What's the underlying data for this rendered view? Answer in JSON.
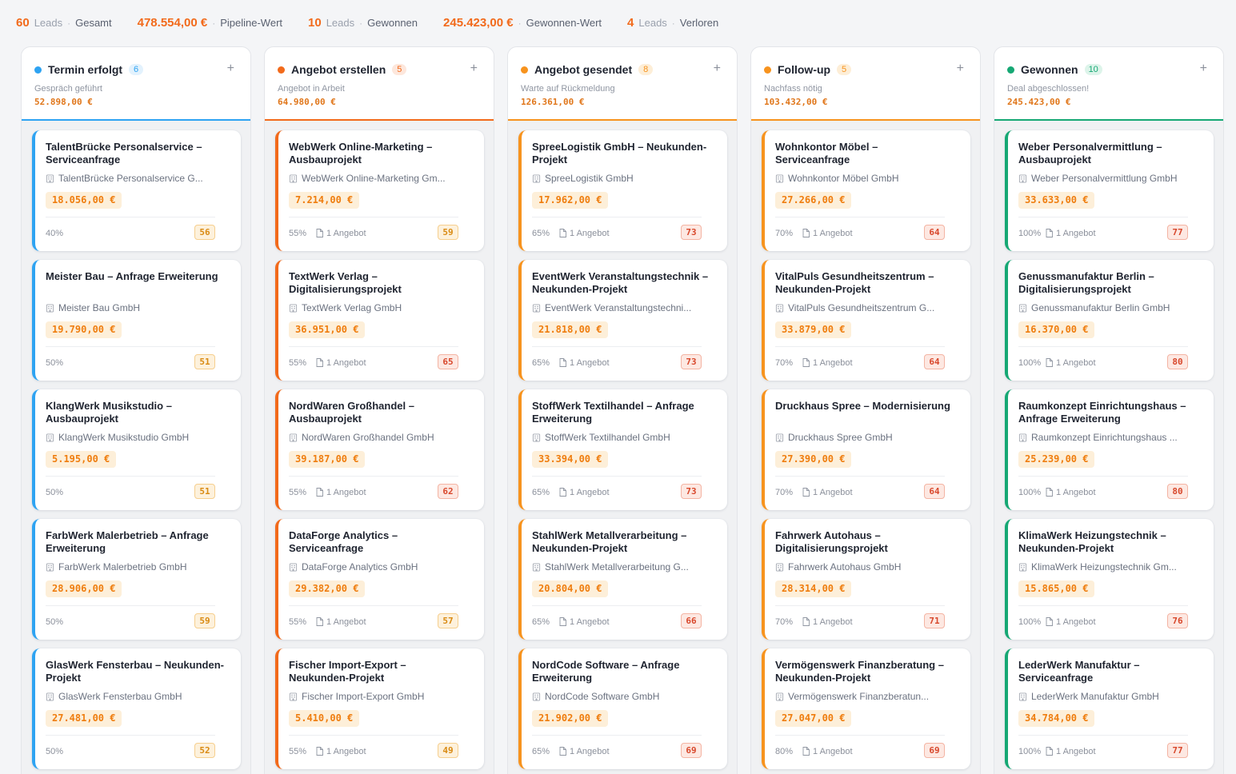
{
  "stats": [
    {
      "value": "60",
      "unit": "Leads",
      "label": "Gesamt"
    },
    {
      "value": "478.554,00 €",
      "unit": "",
      "label": "Pipeline-Wert"
    },
    {
      "value": "10",
      "unit": "Leads",
      "label": "Gewonnen"
    },
    {
      "value": "245.423,00 €",
      "unit": "",
      "label": "Gewonnen-Wert"
    },
    {
      "value": "4",
      "unit": "Leads",
      "label": "Verloren"
    }
  ],
  "columns": [
    {
      "title": "Termin erfolgt",
      "count": "6",
      "subtitle": "Gespräch geführt",
      "sum": "52.898,00 €",
      "accent": "#2ea3f2",
      "accent_soft": "#e3f2fd",
      "add_icon": "plus-icon",
      "cards": [
        {
          "title": "TalentBrücke Personalservice – Serviceanfrage",
          "company": "TalentBrücke Personalservice G...",
          "amount": "18.056,00 €",
          "prob": "40%",
          "offer": "",
          "score": "56",
          "score_color": "yellow"
        },
        {
          "title": "Meister Bau – Anfrage Erweiterung",
          "company": "Meister Bau GmbH",
          "amount": "19.790,00 €",
          "prob": "50%",
          "offer": "",
          "score": "51",
          "score_color": "yellow"
        },
        {
          "title": "KlangWerk Musikstudio – Ausbauprojekt",
          "company": "KlangWerk Musikstudio GmbH",
          "amount": "5.195,00 €",
          "prob": "50%",
          "offer": "",
          "score": "51",
          "score_color": "yellow"
        },
        {
          "title": "FarbWerk Malerbetrieb – Anfrage Erweiterung",
          "company": "FarbWerk Malerbetrieb GmbH",
          "amount": "28.906,00 €",
          "prob": "50%",
          "offer": "",
          "score": "59",
          "score_color": "yellow"
        },
        {
          "title": "GlasWerk Fensterbau – Neukunden-Projekt",
          "company": "GlasWerk Fensterbau GmbH",
          "amount": "27.481,00 €",
          "prob": "50%",
          "offer": "",
          "score": "52",
          "score_color": "yellow"
        }
      ]
    },
    {
      "title": "Angebot erstellen",
      "count": "5",
      "subtitle": "Angebot in Arbeit",
      "sum": "64.980,00 €",
      "accent": "#f26a1b",
      "accent_soft": "#fde7dc",
      "add_icon": "plus-icon",
      "cards": [
        {
          "title": "WebWerk Online-Marketing – Ausbauprojekt",
          "company": "WebWerk Online-Marketing Gm...",
          "amount": "7.214,00 €",
          "prob": "55%",
          "offer": "1 Angebot",
          "score": "59",
          "score_color": "yellow"
        },
        {
          "title": "TextWerk Verlag – Digitalisierungsprojekt",
          "company": "TextWerk Verlag GmbH",
          "amount": "36.951,00 €",
          "prob": "55%",
          "offer": "1 Angebot",
          "score": "65",
          "score_color": "red"
        },
        {
          "title": "NordWaren Großhandel – Ausbauprojekt",
          "company": "NordWaren Großhandel GmbH",
          "amount": "39.187,00 €",
          "prob": "55%",
          "offer": "1 Angebot",
          "score": "62",
          "score_color": "red"
        },
        {
          "title": "DataForge Analytics – Serviceanfrage",
          "company": "DataForge Analytics GmbH",
          "amount": "29.382,00 €",
          "prob": "55%",
          "offer": "1 Angebot",
          "score": "57",
          "score_color": "yellow"
        },
        {
          "title": "Fischer Import-Export – Neukunden-Projekt",
          "company": "Fischer Import-Export GmbH",
          "amount": "5.410,00 €",
          "prob": "55%",
          "offer": "1 Angebot",
          "score": "49",
          "score_color": "yellow"
        }
      ]
    },
    {
      "title": "Angebot gesendet",
      "count": "8",
      "subtitle": "Warte auf Rückmeldung",
      "sum": "126.361,00 €",
      "accent": "#f7931e",
      "accent_soft": "#fdeed7",
      "add_icon": "plus-icon",
      "cards": [
        {
          "title": "SpreeLogistik GmbH – Neukunden-Projekt",
          "company": "SpreeLogistik GmbH",
          "amount": "17.962,00 €",
          "prob": "65%",
          "offer": "1 Angebot",
          "score": "73",
          "score_color": "red"
        },
        {
          "title": "EventWerk Veranstaltungstechnik – Neukunden-Projekt",
          "company": "EventWerk Veranstaltungstechni...",
          "amount": "21.818,00 €",
          "prob": "65%",
          "offer": "1 Angebot",
          "score": "73",
          "score_color": "red"
        },
        {
          "title": "StoffWerk Textilhandel – Anfrage Erweiterung",
          "company": "StoffWerk Textilhandel GmbH",
          "amount": "33.394,00 €",
          "prob": "65%",
          "offer": "1 Angebot",
          "score": "73",
          "score_color": "red"
        },
        {
          "title": "StahlWerk Metallverarbeitung – Neukunden-Projekt",
          "company": "StahlWerk Metallverarbeitung G...",
          "amount": "20.804,00 €",
          "prob": "65%",
          "offer": "1 Angebot",
          "score": "66",
          "score_color": "red"
        },
        {
          "title": "NordCode Software – Anfrage Erweiterung",
          "company": "NordCode Software GmbH",
          "amount": "21.902,00 €",
          "prob": "65%",
          "offer": "1 Angebot",
          "score": "69",
          "score_color": "red"
        }
      ]
    },
    {
      "title": "Follow-up",
      "count": "5",
      "subtitle": "Nachfass nötig",
      "sum": "103.432,00 €",
      "accent": "#f7931e",
      "accent_soft": "#fdeed7",
      "add_icon": "plus-icon",
      "cards": [
        {
          "title": "Wohnkontor Möbel – Serviceanfrage",
          "company": "Wohnkontor Möbel GmbH",
          "amount": "27.266,00 €",
          "prob": "70%",
          "offer": "1 Angebot",
          "score": "64",
          "score_color": "red"
        },
        {
          "title": "VitalPuls Gesundheitszentrum – Neukunden-Projekt",
          "company": "VitalPuls Gesundheitszentrum G...",
          "amount": "33.879,00 €",
          "prob": "70%",
          "offer": "1 Angebot",
          "score": "64",
          "score_color": "red"
        },
        {
          "title": "Druckhaus Spree – Modernisierung",
          "company": "Druckhaus Spree GmbH",
          "amount": "27.390,00 €",
          "prob": "70%",
          "offer": "1 Angebot",
          "score": "64",
          "score_color": "red"
        },
        {
          "title": "Fahrwerk Autohaus – Digitalisierungsprojekt",
          "company": "Fahrwerk Autohaus GmbH",
          "amount": "28.314,00 €",
          "prob": "70%",
          "offer": "1 Angebot",
          "score": "71",
          "score_color": "red"
        },
        {
          "title": "Vermögenswerk Finanzberatung – Neukunden-Projekt",
          "company": "Vermögenswerk Finanzberatun...",
          "amount": "27.047,00 €",
          "prob": "80%",
          "offer": "1 Angebot",
          "score": "69",
          "score_color": "red"
        }
      ]
    },
    {
      "title": "Gewonnen",
      "count": "10",
      "subtitle": "Deal abgeschlossen!",
      "sum": "245.423,00 €",
      "accent": "#16a874",
      "accent_soft": "#ddf4ea",
      "add_icon": "plus-icon",
      "cards": [
        {
          "title": "Weber Personalvermittlung – Ausbauprojekt",
          "company": "Weber Personalvermittlung GmbH",
          "amount": "33.633,00 €",
          "prob": "100%",
          "offer": "1 Angebot",
          "score": "77",
          "score_color": "red"
        },
        {
          "title": "Genussmanufaktur Berlin – Digitalisierungsprojekt",
          "company": "Genussmanufaktur Berlin GmbH",
          "amount": "16.370,00 €",
          "prob": "100%",
          "offer": "1 Angebot",
          "score": "80",
          "score_color": "red"
        },
        {
          "title": "Raumkonzept Einrichtungshaus – Anfrage Erweiterung",
          "company": "Raumkonzept Einrichtungshaus ...",
          "amount": "25.239,00 €",
          "prob": "100%",
          "offer": "1 Angebot",
          "score": "80",
          "score_color": "red"
        },
        {
          "title": "KlimaWerk Heizungstechnik – Neukunden-Projekt",
          "company": "KlimaWerk Heizungstechnik Gm...",
          "amount": "15.865,00 €",
          "prob": "100%",
          "offer": "1 Angebot",
          "score": "76",
          "score_color": "red"
        },
        {
          "title": "LederWerk Manufaktur – Serviceanfrage",
          "company": "LederWerk Manufaktur GmbH",
          "amount": "34.784,00 €",
          "prob": "100%",
          "offer": "1 Angebot",
          "score": "77",
          "score_color": "red"
        }
      ]
    }
  ]
}
